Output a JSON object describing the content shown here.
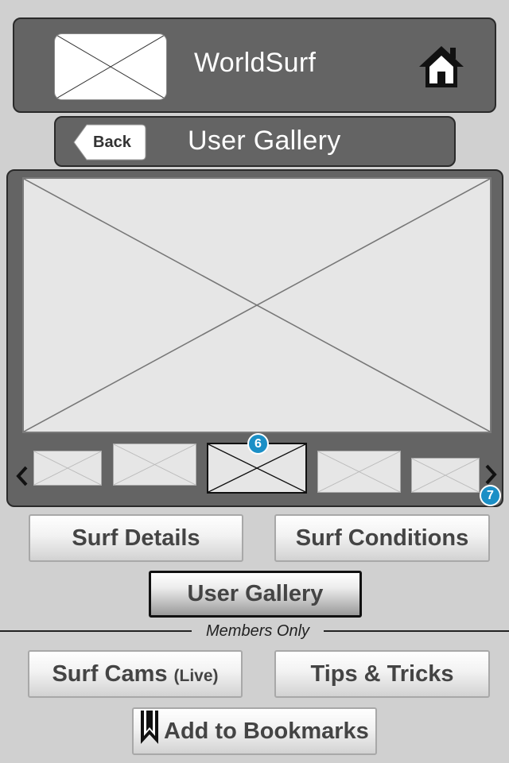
{
  "header": {
    "title": "WorldSurf",
    "logo_icon": "image-placeholder-icon",
    "home_icon": "home-icon"
  },
  "subheader": {
    "back_label": "Back",
    "title": "User Gallery"
  },
  "gallery": {
    "main_image_icon": "image-placeholder-icon",
    "prev_icon": "chevron-left-icon",
    "next_icon": "chevron-right-icon",
    "selected_badge": "6",
    "next_badge": "7"
  },
  "nav": {
    "surf_details": "Surf Details",
    "surf_conditions": "Surf Conditions",
    "user_gallery": "User Gallery",
    "members_only": "Members Only",
    "surf_cams": "Surf Cams",
    "surf_cams_sub": "(Live)",
    "tips_tricks": "Tips & Tricks",
    "add_bookmarks": "Add to Bookmarks",
    "bookmark_icon": "bookmark-icon"
  },
  "colors": {
    "background": "#d0d0d0",
    "panel": "#646464",
    "badge": "#1b8fc6"
  }
}
